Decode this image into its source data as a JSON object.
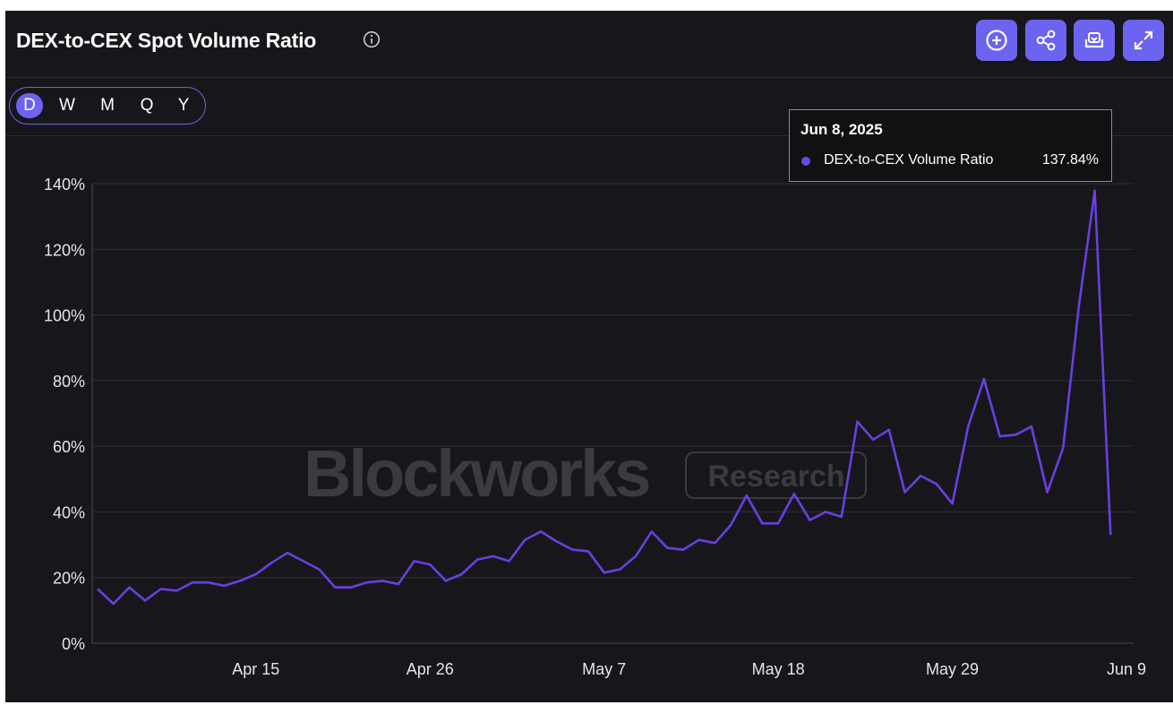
{
  "header": {
    "title": "DEX-to-CEX Spot Volume Ratio",
    "toolbar": [
      {
        "name": "add-button",
        "icon": "plus-circle-icon"
      },
      {
        "name": "share-button",
        "icon": "share-icon"
      },
      {
        "name": "download-button",
        "icon": "download-icon"
      },
      {
        "name": "expand-button",
        "icon": "expand-icon"
      }
    ]
  },
  "periods": {
    "items": [
      "D",
      "W",
      "M",
      "Q",
      "Y"
    ],
    "active": "D"
  },
  "watermark": {
    "brand": "Blockworks",
    "badge": "Research"
  },
  "tooltip": {
    "date": "Jun 8, 2025",
    "series_name": "DEX-to-CEX Volume Ratio",
    "value": "137.84%"
  },
  "colors": {
    "background": "#17171b",
    "accent": "#6c63f0",
    "line": "#6a3fe0",
    "grid": "#2e2e35",
    "text": "#ffffff"
  },
  "chart_data": {
    "type": "line",
    "title": "DEX-to-CEX Spot Volume Ratio",
    "ylim": [
      0,
      140
    ],
    "y_ticks": [
      "0%",
      "20%",
      "40%",
      "60%",
      "80%",
      "100%",
      "120%",
      "140%"
    ],
    "x_ticks": [
      "Apr 15",
      "Apr 26",
      "May 7",
      "May 18",
      "May 29",
      "Jun 9"
    ],
    "grid": true,
    "x": [
      "Apr 5",
      "Apr 6",
      "Apr 7",
      "Apr 8",
      "Apr 9",
      "Apr 10",
      "Apr 11",
      "Apr 12",
      "Apr 13",
      "Apr 14",
      "Apr 15",
      "Apr 16",
      "Apr 17",
      "Apr 18",
      "Apr 19",
      "Apr 20",
      "Apr 21",
      "Apr 22",
      "Apr 23",
      "Apr 24",
      "Apr 25",
      "Apr 26",
      "Apr 27",
      "Apr 28",
      "Apr 29",
      "Apr 30",
      "May 1",
      "May 2",
      "May 3",
      "May 4",
      "May 5",
      "May 6",
      "May 7",
      "May 8",
      "May 9",
      "May 10",
      "May 11",
      "May 12",
      "May 13",
      "May 14",
      "May 15",
      "May 16",
      "May 17",
      "May 18",
      "May 19",
      "May 20",
      "May 21",
      "May 22",
      "May 23",
      "May 24",
      "May 25",
      "May 26",
      "May 27",
      "May 28",
      "May 29",
      "May 30",
      "May 31",
      "Jun 1",
      "Jun 2",
      "Jun 3",
      "Jun 4",
      "Jun 5",
      "Jun 6",
      "Jun 7",
      "Jun 8",
      "Jun 9"
    ],
    "series": [
      {
        "name": "DEX-to-CEX Volume Ratio",
        "values": [
          16.5,
          12,
          17,
          13,
          16.5,
          16,
          18.5,
          18.5,
          17.5,
          19,
          21,
          24.5,
          27.5,
          25,
          22.5,
          17,
          17,
          18.5,
          19,
          18,
          25,
          24,
          19,
          21,
          25.5,
          26.5,
          25,
          31.5,
          34,
          31,
          28.5,
          28,
          21.5,
          22.5,
          26.5,
          34,
          29,
          28.5,
          31.5,
          30.5,
          36,
          45,
          36.5,
          36.5,
          45.5,
          37.5,
          40,
          38.5,
          67.5,
          62,
          65,
          46,
          51,
          48.5,
          42.5,
          66,
          80.5,
          63,
          63.5,
          66,
          46,
          59.5,
          103,
          137.84,
          33
        ]
      }
    ]
  }
}
